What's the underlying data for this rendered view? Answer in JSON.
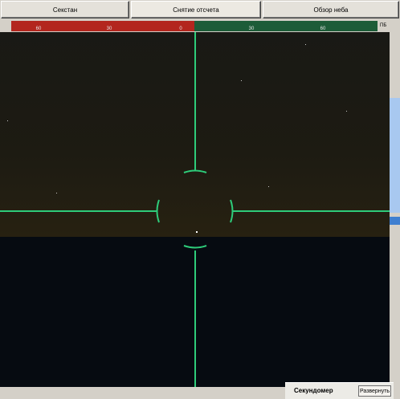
{
  "tabs": [
    {
      "label": "Секстан"
    },
    {
      "label": "Снятие отсчета"
    },
    {
      "label": "Обзор неба"
    }
  ],
  "scale": {
    "red_ticks": [
      "60",
      "30",
      "0"
    ],
    "green_ticks": [
      "30",
      "60"
    ],
    "side_label": "ПБ",
    "colors": {
      "port": "#b3261e",
      "starboard": "#1d5c38"
    }
  },
  "stopwatch": {
    "title": "Секундомер",
    "expand_label": "Развернуть"
  },
  "colors": {
    "reticle": "#2ecc7a",
    "sky": "#1d1b12",
    "sea": "#060b11"
  }
}
